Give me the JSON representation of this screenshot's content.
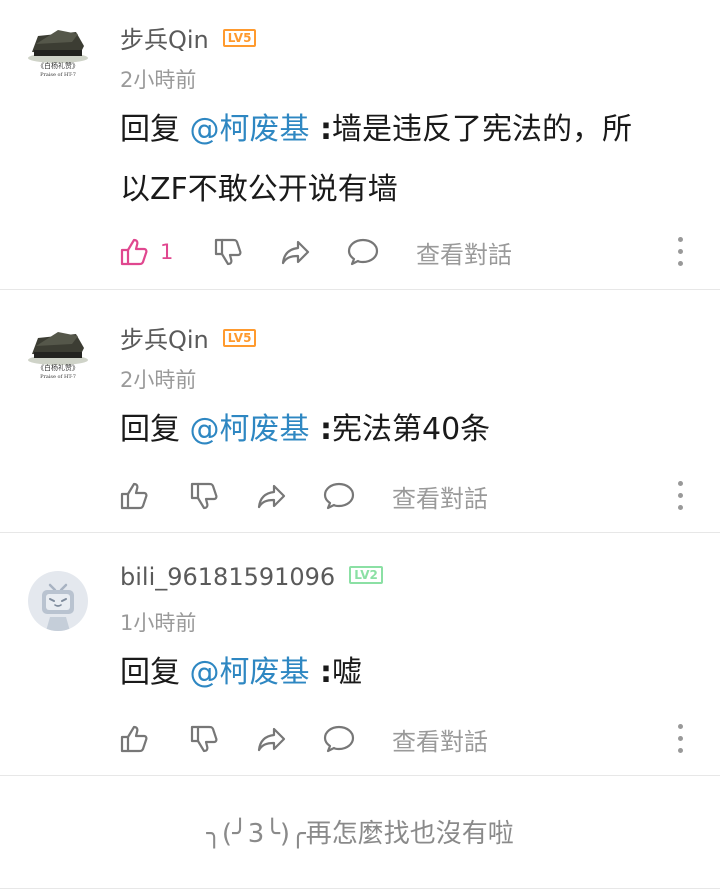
{
  "comments": [
    {
      "username": "步兵Qin",
      "level": "LV5",
      "time": "2小時前",
      "reply_prefix": "回复 ",
      "mention": "@柯废基",
      "colon": " :",
      "text_line1": "墙是违反了宪法的，所",
      "text_line2": "以ZF不敢公开说有墙",
      "like_count": "1",
      "view_conversation": "查看對話",
      "avatar_caption": "《白杨礼赞》",
      "avatar_caption_en": "Praise of HT-7"
    },
    {
      "username": "步兵Qin",
      "level": "LV5",
      "time": "2小時前",
      "reply_prefix": "回复 ",
      "mention": "@柯废基",
      "colon": " :",
      "text": "宪法第40条",
      "view_conversation": "查看對話",
      "avatar_caption": "《白杨礼赞》",
      "avatar_caption_en": "Praise of HT-7"
    },
    {
      "username": "bili_96181591096",
      "level": "LV2",
      "time": "1小時前",
      "reply_prefix": "回复 ",
      "mention": "@柯废基",
      "colon": " :",
      "text": "嘘",
      "view_conversation": "查看對話"
    }
  ],
  "footer": {
    "text": "╮(╯3╰)╭再怎麼找也沒有啦"
  },
  "colors": {
    "mention": "#2e87c2",
    "like_active": "#e0478f",
    "lv5": "#ff9a2e",
    "lv2": "#8be0a4"
  }
}
